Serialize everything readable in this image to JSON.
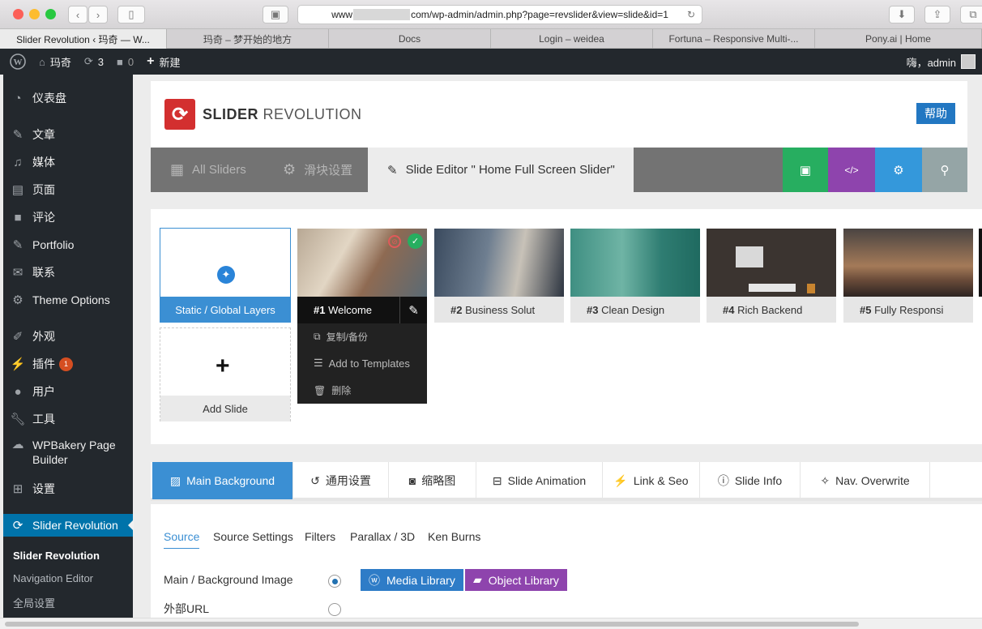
{
  "browser": {
    "url_prefix": "www",
    "url_suffix": "com/wp-admin/admin.php?page=revslider&view=slide&id=1",
    "tabs": [
      "Slider Revolution ‹ 玛奇 — W...",
      "玛奇 – 梦开始的地方",
      "Docs",
      "Login – weidea",
      "Fortuna – Responsive Multi-...",
      "Pony.ai | Home"
    ]
  },
  "adminbar": {
    "site": "玛奇",
    "updates": "3",
    "comments": "0",
    "new": "新建",
    "greeting": "嗨，admin"
  },
  "menu": {
    "items": [
      "仪表盘",
      "文章",
      "媒体",
      "页面",
      "评论",
      "Portfolio",
      "联系",
      "Theme Options",
      "外观",
      "插件",
      "用户",
      "工具",
      "WPBakery Page Builder",
      "设置",
      "Slider Revolution"
    ],
    "plugin_badge": "1",
    "sub": [
      "Slider Revolution",
      "Navigation Editor",
      "全局设置"
    ]
  },
  "header": {
    "logo_bold": "SLIDER",
    "logo_light": "REVOLUTION",
    "help": "帮助"
  },
  "toptabs": {
    "all_sliders": "All Sliders",
    "slider_settings": "滑块设置",
    "editor": "Slide Editor \" Home Full Screen Slider\""
  },
  "colors": {
    "save": "#27ae60",
    "code": "#8e44ad",
    "settings": "#3498db",
    "search": "#95a5a6",
    "wp_blue": "#0073aa"
  },
  "slides": {
    "static": "Static / Global Layers",
    "add": "Add Slide",
    "list": [
      {
        "num": "#1",
        "title": "Welcome"
      },
      {
        "num": "#2",
        "title": "Business Solut"
      },
      {
        "num": "#3",
        "title": "Clean Design"
      },
      {
        "num": "#4",
        "title": "Rich Backend"
      },
      {
        "num": "#5",
        "title": "Fully Responsi"
      }
    ],
    "menu": [
      "复制/备份",
      "Add to Templates",
      "删除"
    ]
  },
  "paneltabs": [
    "Main Background",
    "通用设置",
    "缩略图",
    "Slide Animation",
    "Link & Seo",
    "Slide Info",
    "Nav. Overwrite"
  ],
  "bg": {
    "subtabs": [
      "Source",
      "Source Settings",
      "Filters",
      "Parallax / 3D",
      "Ken Burns"
    ],
    "opt1": "Main / Background Image",
    "opt2": "外部URL",
    "media": "Media Library",
    "object": "Object Library"
  }
}
